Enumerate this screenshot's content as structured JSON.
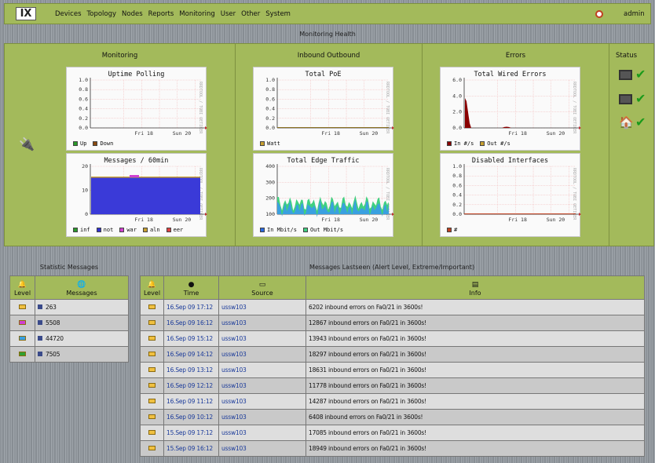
{
  "topbar": {
    "logo": "IX",
    "menu": [
      "Devices",
      "Topology",
      "Nodes",
      "Reports",
      "Monitoring",
      "User",
      "Other",
      "System"
    ],
    "user": "admin"
  },
  "health": {
    "title": "Monitoring Health",
    "columns": [
      "Monitoring",
      "Inbound Outbound",
      "Errors",
      "Status"
    ]
  },
  "graphs": [
    {
      "title": "Uptime Polling",
      "y": [
        "1.0",
        "0.8",
        "0.6",
        "0.4",
        "0.2",
        "0.0"
      ],
      "x": [
        "Fri 18",
        "Sun 20"
      ],
      "legend": [
        [
          "Up",
          "#2a9a2a"
        ],
        [
          "Down",
          "#8a4a10"
        ]
      ]
    },
    {
      "title": "Total PoE",
      "y": [
        "1.0",
        "0.8",
        "0.6",
        "0.4",
        "0.2",
        "0.0"
      ],
      "x": [
        "Fri 18",
        "Sun 20"
      ],
      "legend": [
        [
          "Watt",
          "#c8a030"
        ]
      ]
    },
    {
      "title": "Total Wired Errors",
      "y": [
        "6.0",
        "4.0",
        "2.0",
        "0.0"
      ],
      "x": [
        "Fri 18",
        "Sun 20"
      ],
      "legend": [
        [
          "In #/s",
          "#8a0000"
        ],
        [
          "Out #/s",
          "#c8a030"
        ]
      ]
    },
    {
      "title": "Messages / 60min",
      "y": [
        "20",
        "10",
        "0"
      ],
      "x": [
        "Fri 18",
        "Sun 20"
      ],
      "legend": [
        [
          "inf",
          "#2a9a2a"
        ],
        [
          "not",
          "#3030d0"
        ],
        [
          "war",
          "#d040d0"
        ],
        [
          "aln",
          "#c8a030"
        ],
        [
          "eer",
          "#e04040"
        ]
      ]
    },
    {
      "title": "Total Edge Traffic",
      "y": [
        "400",
        "300",
        "200",
        "100"
      ],
      "x": [
        "Fri 18",
        "Sun 20"
      ],
      "legend": [
        [
          "In Mbit/s",
          "#2a6ae0"
        ],
        [
          "Out Mbit/s",
          "#40d080"
        ]
      ]
    },
    {
      "title": "Disabled Interfaces",
      "y": [
        "1.0",
        "0.8",
        "0.6",
        "0.4",
        "0.2",
        "0.0"
      ],
      "x": [
        "Fri 18",
        "Sun 20"
      ],
      "legend": [
        [
          "#",
          "#c04020"
        ]
      ]
    }
  ],
  "graph_side": "RRDTOOL / TOBI OETIKER",
  "stats": {
    "title": "Statistic Messages",
    "h_level": "Level",
    "h_messages": "Messages",
    "rows": [
      {
        "value": "263",
        "color": "#f0c040"
      },
      {
        "value": "5508",
        "color": "#d040d0"
      },
      {
        "value": "44720",
        "color": "#3aa0e0"
      },
      {
        "value": "7505",
        "color": "#30a030"
      }
    ]
  },
  "last": {
    "title": "Messages Lastseen (Alert Level, Extreme/Important)",
    "h_level": "Level",
    "h_time": "Time",
    "h_source": "Source",
    "h_info": "Info",
    "rows": [
      [
        "16.Sep 09 17:12",
        "ussw103",
        "6202 inbound errors on Fa0/21 in 3600s!"
      ],
      [
        "16.Sep 09 16:12",
        "ussw103",
        "12867 inbound errors on Fa0/21 in 3600s!"
      ],
      [
        "16.Sep 09 15:12",
        "ussw103",
        "13943 inbound errors on Fa0/21 in 3600s!"
      ],
      [
        "16.Sep 09 14:12",
        "ussw103",
        "18297 inbound errors on Fa0/21 in 3600s!"
      ],
      [
        "16.Sep 09 13:12",
        "ussw103",
        "18631 inbound errors on Fa0/21 in 3600s!"
      ],
      [
        "16.Sep 09 12:12",
        "ussw103",
        "11778 inbound errors on Fa0/21 in 3600s!"
      ],
      [
        "16.Sep 09 11:12",
        "ussw103",
        "14287 inbound errors on Fa0/21 in 3600s!"
      ],
      [
        "16.Sep 09 10:12",
        "ussw103",
        "6408 inbound errors on Fa0/21 in 3600s!"
      ],
      [
        "15.Sep 09 17:12",
        "ussw103",
        "17085 inbound errors on Fa0/21 in 3600s!"
      ],
      [
        "15.Sep 09 16:12",
        "ussw103",
        "18949 inbound errors on Fa0/21 in 3600s!"
      ]
    ]
  }
}
